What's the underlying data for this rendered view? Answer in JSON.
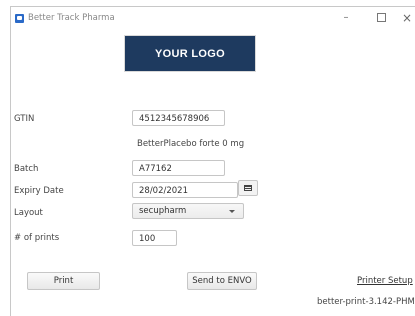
{
  "window": {
    "title": "Better Track Pharma",
    "minimize_glyph": "–",
    "close_glyph": "×"
  },
  "logo": {
    "text": "YOUR LOGO"
  },
  "form": {
    "gtin_label": "GTIN",
    "gtin_value": "4512345678906",
    "product_name": "BetterPlacebo forte 0 mg",
    "batch_label": "Batch",
    "batch_value": "A77162",
    "expiry_label": "Expiry Date",
    "expiry_value": "28/02/2021",
    "layout_label": "Layout",
    "layout_value": "secupharm",
    "prints_label": "# of prints",
    "prints_value": "100"
  },
  "actions": {
    "print_label": "Print",
    "send_label": "Send to ENVO",
    "printer_setup_label": "Printer Setup"
  },
  "footer": {
    "version": "better-print-3.142-PHM"
  },
  "icons": {
    "app": "app-icon",
    "calendar": "calendar-icon",
    "dropdown": "chevron-down-icon"
  },
  "colors": {
    "logo_bg": "#1e3a5f",
    "app_icon": "#2a6ac8"
  }
}
